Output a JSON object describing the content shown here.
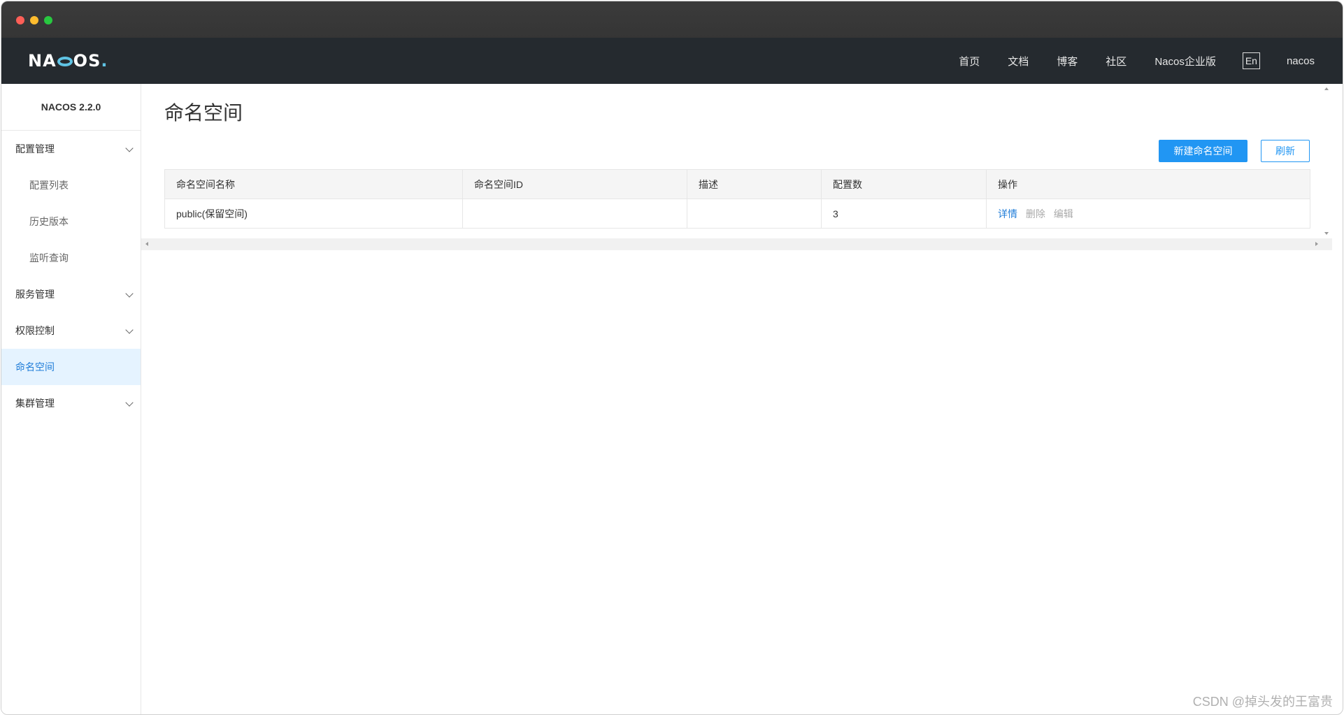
{
  "window": {
    "controls": [
      "close",
      "minimize",
      "zoom"
    ]
  },
  "topnav": {
    "logo": "NACOS.",
    "links": [
      "首页",
      "文档",
      "博客",
      "社区",
      "Nacos企业版"
    ],
    "lang": "En",
    "user": "nacos"
  },
  "sidebar": {
    "version": "NACOS 2.2.0",
    "items": [
      {
        "label": "配置管理",
        "type": "group",
        "expanded": true
      },
      {
        "label": "配置列表",
        "type": "sub"
      },
      {
        "label": "历史版本",
        "type": "sub"
      },
      {
        "label": "监听查询",
        "type": "sub"
      },
      {
        "label": "服务管理",
        "type": "group"
      },
      {
        "label": "权限控制",
        "type": "group"
      },
      {
        "label": "命名空间",
        "type": "item",
        "active": true
      },
      {
        "label": "集群管理",
        "type": "group"
      }
    ]
  },
  "main": {
    "title": "命名空间",
    "buttons": {
      "create": "新建命名空间",
      "refresh": "刷新"
    },
    "table": {
      "columns": [
        "命名空间名称",
        "命名空间ID",
        "描述",
        "配置数",
        "操作"
      ],
      "rows": [
        {
          "name": "public(保留空间)",
          "id": "",
          "desc": "",
          "count": "3",
          "ops": [
            "详情",
            "删除",
            "编辑"
          ]
        }
      ]
    }
  },
  "watermark": "CSDN @掉头发的王富贵",
  "colors": {
    "accent": "#2196f3",
    "nav_bg": "#252a2f",
    "active_bg": "#e5f3ff",
    "logo_accent": "#5fc3e4"
  }
}
